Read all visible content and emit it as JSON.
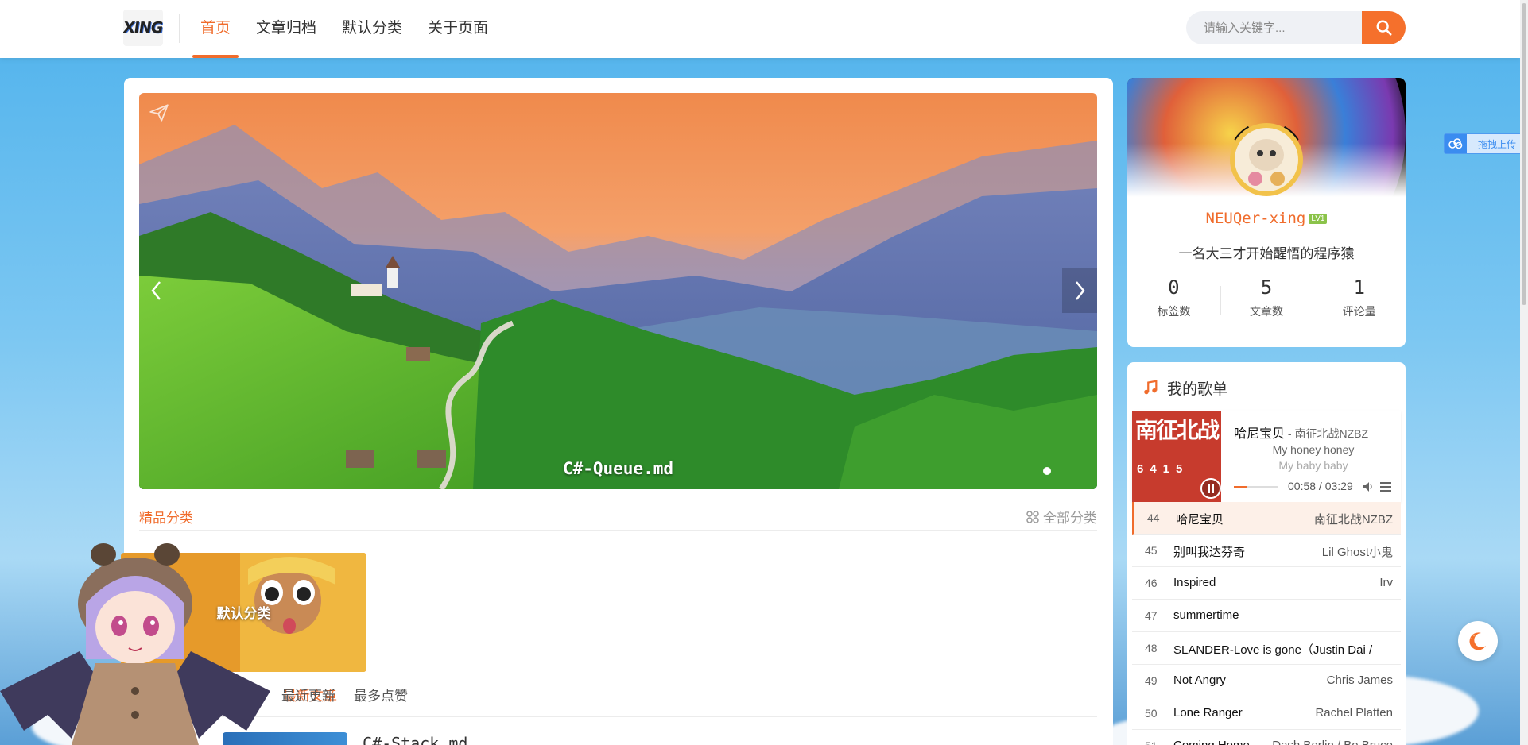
{
  "header": {
    "logo_text": "XING",
    "nav": [
      {
        "label": "首页",
        "active": true
      },
      {
        "label": "文章归档",
        "active": false
      },
      {
        "label": "默认分类",
        "active": false
      },
      {
        "label": "关于页面",
        "active": false
      }
    ],
    "search_placeholder": "请输入关键字...",
    "search_icon": "search-icon"
  },
  "banner": {
    "caption": "C#-Queue.md",
    "prev_icon": "chevron-left-icon",
    "next_icon": "chevron-right-icon"
  },
  "categories": {
    "title": "精品分类",
    "all_label": "全部分类",
    "items": [
      {
        "label": "默认分类"
      }
    ]
  },
  "sort_tabs": [
    {
      "label": "最新文章",
      "active": true
    },
    {
      "label": "最近更新",
      "active": false
    },
    {
      "label": "最多点赞",
      "active": false
    }
  ],
  "posts": [
    {
      "title": "C#-Stack.md"
    }
  ],
  "profile": {
    "name": "NEUQer-xing",
    "level": "LV1",
    "bio": "一名大三才开始醒悟的程序猿",
    "stats": [
      {
        "value": "0",
        "label": "标签数"
      },
      {
        "value": "5",
        "label": "文章数"
      },
      {
        "value": "1",
        "label": "评论量"
      }
    ]
  },
  "playlist": {
    "title": "我的歌单",
    "player": {
      "song": "哈尼宝贝",
      "artist": " - 南征北战NZBZ",
      "lyric_current": "My honey honey",
      "lyric_next": "My baby baby",
      "time": "00:58 / 03:29",
      "progress": 0.28,
      "album_text": "南征北战",
      "album_digits": "6415"
    },
    "tracks": [
      {
        "num": "44",
        "name": "哈尼宝贝",
        "artist": "南征北战NZBZ",
        "active": true
      },
      {
        "num": "45",
        "name": "别叫我达芬奇",
        "artist": "Lil Ghost小鬼",
        "active": false
      },
      {
        "num": "46",
        "name": "Inspired",
        "artist": "Irv",
        "active": false
      },
      {
        "num": "47",
        "name": "summertime",
        "artist": "",
        "active": false
      },
      {
        "num": "48",
        "name": "SLANDER-Love is gone（Justin Dai /",
        "artist": "",
        "active": false
      },
      {
        "num": "49",
        "name": "Not Angry",
        "artist": "Chris James",
        "active": false
      },
      {
        "num": "50",
        "name": "Lone Ranger",
        "artist": "Rachel Platten",
        "active": false
      },
      {
        "num": "51",
        "name": "Coming Home",
        "artist": "Dash Berlin / Bo Bruce",
        "active": false
      }
    ]
  },
  "widgets": {
    "upload_label": "拖拽上传",
    "theme_icon": "moon-icon"
  },
  "colors": {
    "accent": "#f06c2c",
    "search_button": "#f5702c",
    "sky": "#4fb2ec"
  }
}
